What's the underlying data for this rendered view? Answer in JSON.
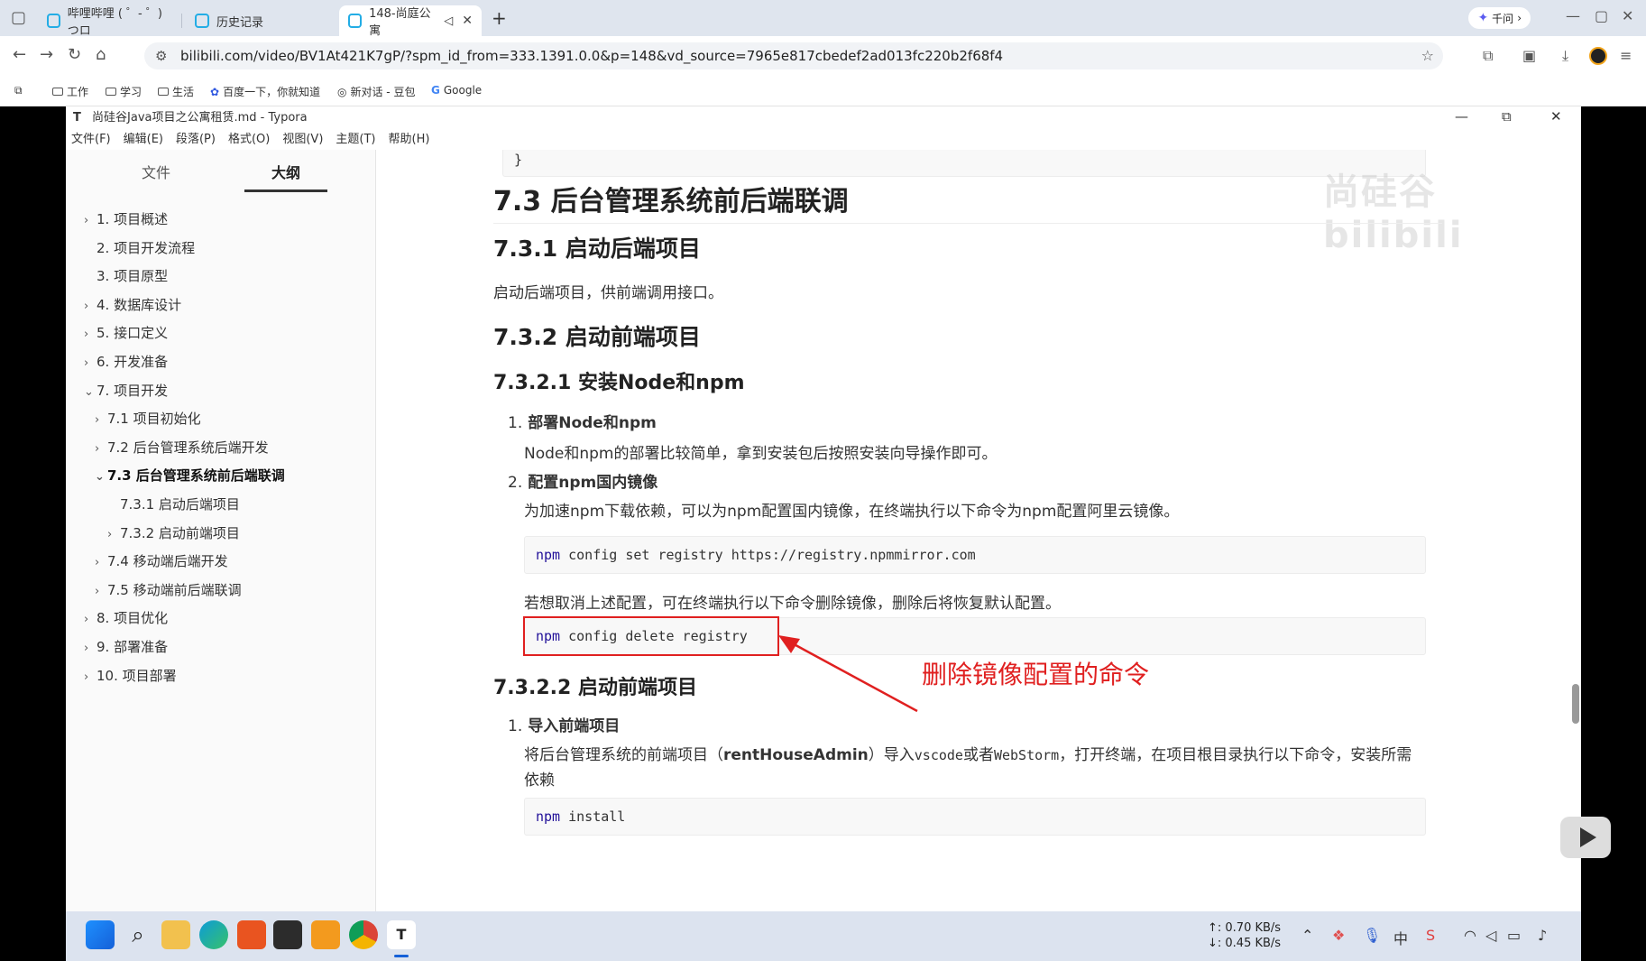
{
  "browser": {
    "tabs": [
      {
        "label": "哔哩哔哩 ( ゜- ゜)つロ"
      },
      {
        "label": "历史记录"
      },
      {
        "label": "148-尚庭公寓"
      }
    ],
    "new_tab": "+",
    "qianwen": "千问",
    "url": "bilibili.com/video/BV1At421K7gP/?spm_id_from=333.1391.0.0&p=148&vd_source=7965e817cbedef2ad013fc220b2f68f4",
    "bookmarks": [
      "工作",
      "学习",
      "生活",
      "百度一下，你就知道",
      "新对话 - 豆包",
      "Google"
    ]
  },
  "typora": {
    "title": "尚硅谷Java项目之公寓租赁.md - Typora",
    "app_initial": "T",
    "menu": [
      "文件(F)",
      "编辑(E)",
      "段落(P)",
      "格式(O)",
      "视图(V)",
      "主题(T)",
      "帮助(H)"
    ],
    "sidebar_tabs": [
      "文件",
      "大纲"
    ],
    "outline": [
      {
        "label": "1. 项目概述",
        "chevron": "›",
        "level": 0
      },
      {
        "label": "2. 项目开发流程",
        "chevron": "",
        "level": 0
      },
      {
        "label": "3. 项目原型",
        "chevron": "",
        "level": 0
      },
      {
        "label": "4. 数据库设计",
        "chevron": "›",
        "level": 0
      },
      {
        "label": "5. 接口定义",
        "chevron": "›",
        "level": 0
      },
      {
        "label": "6. 开发准备",
        "chevron": "›",
        "level": 0
      },
      {
        "label": "7. 项目开发",
        "chevron": "⌄",
        "level": 0
      },
      {
        "label": "7.1 项目初始化",
        "chevron": "›",
        "level": 1
      },
      {
        "label": "7.2 后台管理系统后端开发",
        "chevron": "›",
        "level": 1
      },
      {
        "label": "7.3 后台管理系统前后端联调",
        "chevron": "⌄",
        "level": 1,
        "bold": true
      },
      {
        "label": "7.3.1 启动后端项目",
        "chevron": "",
        "level": 2
      },
      {
        "label": "7.3.2 启动前端项目",
        "chevron": "›",
        "level": 2
      },
      {
        "label": "7.4 移动端后端开发",
        "chevron": "›",
        "level": 1
      },
      {
        "label": "7.5 移动端前后端联调",
        "chevron": "›",
        "level": 1
      },
      {
        "label": "8. 项目优化",
        "chevron": "›",
        "level": 0
      },
      {
        "label": "9. 部署准备",
        "chevron": "›",
        "level": 0
      },
      {
        "label": "10. 项目部署",
        "chevron": "›",
        "level": 0
      }
    ],
    "doc": {
      "code_tail": "}",
      "h2": "7.3 后台管理系统前后端联调",
      "h3_1": "7.3.1 启动后端项目",
      "p1": "启动后端项目，供前端调用接口。",
      "h3_2": "7.3.2 启动前端项目",
      "h4_1": "7.3.2.1 安装Node和npm",
      "li1_num": "1.",
      "li1": "部署Node和npm",
      "p2": "Node和npm的部署比较简单，拿到安装包后按照安装向导操作即可。",
      "li2_num": "2.",
      "li2": "配置npm国内镜像",
      "p3": "为加速npm下载依赖，可以为npm配置国内镜像，在终端执行以下命令为npm配置阿里云镜像。",
      "code1_kw": "npm",
      "code1": " config set registry https://registry.npmmirror.com",
      "p4": "若想取消上述配置，可在终端执行以下命令删除镜像，删除后将恢复默认配置。",
      "code2_kw": "npm",
      "code2": " config delete registry",
      "annotation": "删除镜像配置的命令",
      "h4_2": "7.3.2.2 启动前端项目",
      "li3_num": "1.",
      "li3": "导入前端项目",
      "p5_a": "将后台管理系统的前端项目（",
      "p5_b": "rentHouseAdmin",
      "p5_c": "）导入",
      "p5_d": "vscode",
      "p5_e": "或者",
      "p5_f": "WebStorm",
      "p5_g": "，打开终端，在项目根目录执行以下命令，安装所需",
      "p5_h": "依赖",
      "code3_kw": "npm",
      "code3": " install",
      "watermark": "尚硅谷 bilibili"
    }
  },
  "taskbar": {
    "net_up": "↑: 0.70 KB/s",
    "net_down": "↓: 0.45 KB/s"
  }
}
